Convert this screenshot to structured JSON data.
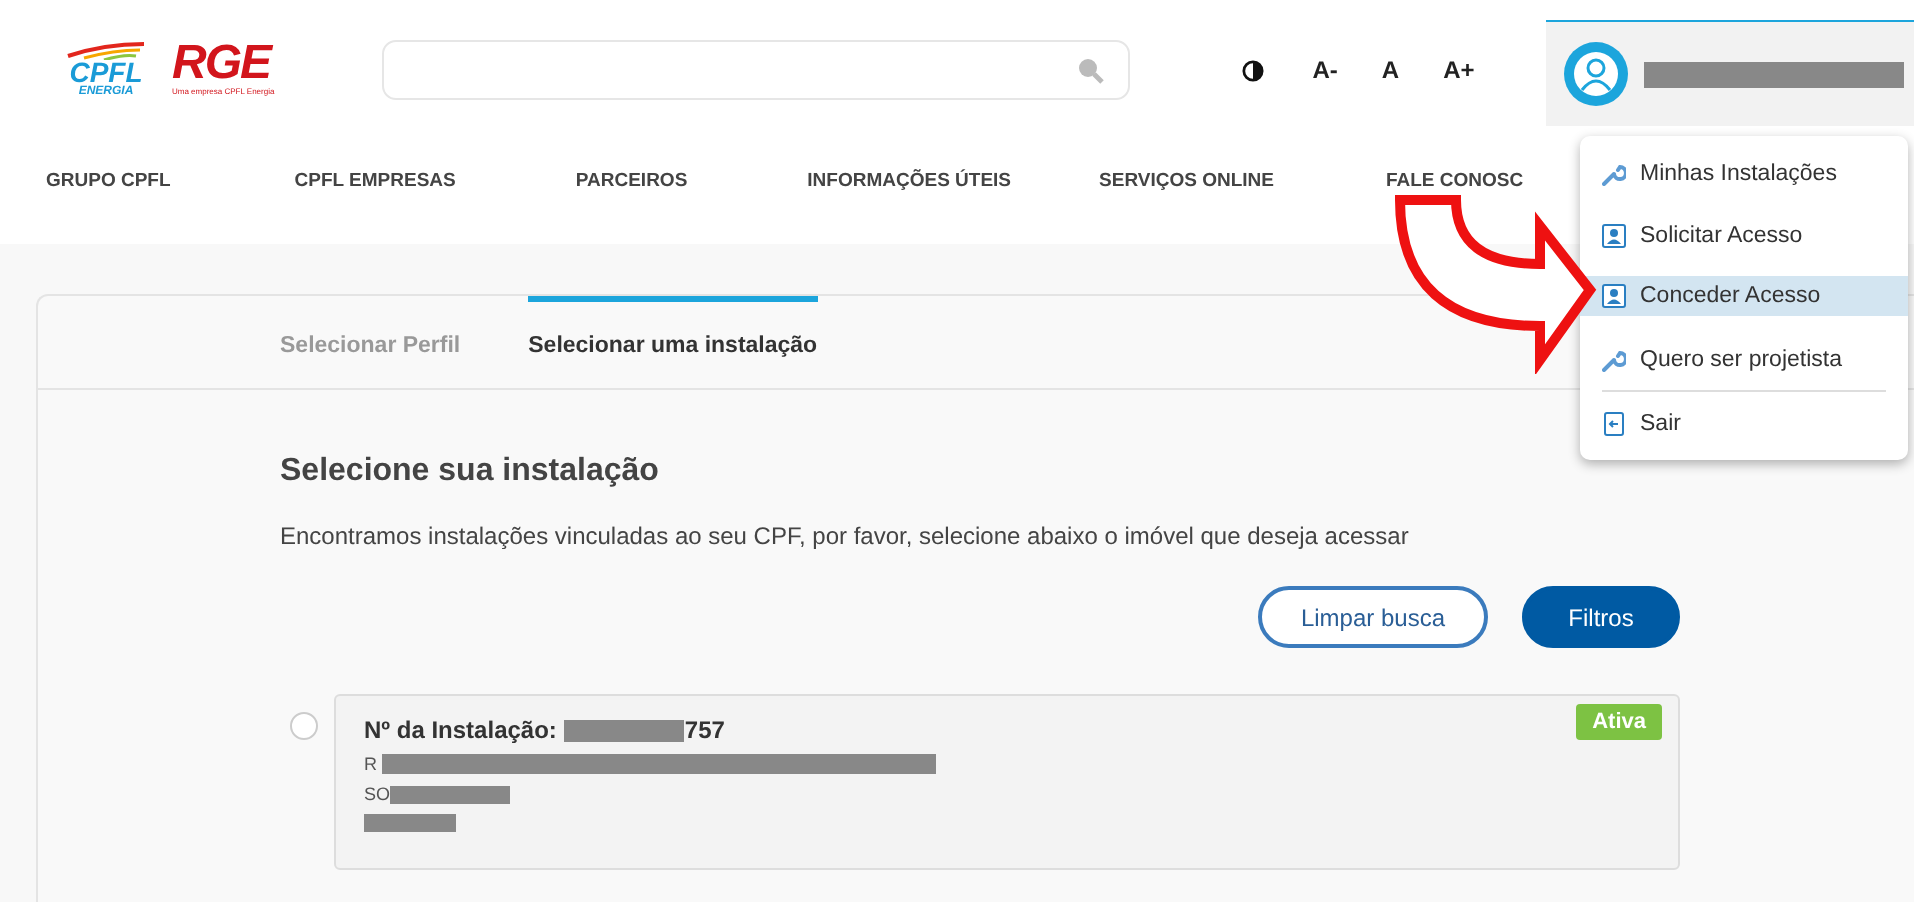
{
  "header": {
    "logo_primary": "CPFL",
    "logo_primary_sub": "ENERGIA",
    "logo_secondary": "RGE",
    "logo_secondary_tagline": "Uma empresa CPFL Energia",
    "accessibility": [
      "A-",
      "A",
      "A+"
    ]
  },
  "nav": [
    "GRUPO CPFL",
    "CPFL EMPRESAS",
    "PARCEIROS",
    "INFORMAÇÕES ÚTEIS",
    "SERVIÇOS ONLINE",
    "FALE CONOSC"
  ],
  "user_menu": {
    "items": [
      {
        "label": "Minhas Instalações",
        "kind": "wrench",
        "selected": false
      },
      {
        "label": "Solicitar Acesso",
        "kind": "person",
        "selected": false
      },
      {
        "label": "Conceder Acesso",
        "kind": "person",
        "selected": true
      },
      {
        "label": "Quero ser projetista",
        "kind": "wrench",
        "selected": false
      },
      {
        "label": "Sair",
        "kind": "exit",
        "selected": false
      }
    ]
  },
  "steps": [
    {
      "label": "Selecionar Perfil",
      "selected": false
    },
    {
      "label": "Selecionar uma instalação",
      "selected": true
    }
  ],
  "title": "Selecione sua instalação",
  "description": "Encontramos instalações vinculadas ao seu CPF, por favor, selecione abaixo o imóvel que deseja acessar",
  "buttons": [
    {
      "label": "Limpar busca",
      "kind": "outline"
    },
    {
      "label": "Filtros",
      "kind": "filled"
    }
  ],
  "installations": [
    {
      "number_label": "Nº da Instalação:",
      "number_suffix": "757",
      "address_start": "R",
      "city_start": "SO",
      "status": "Ativa",
      "selected": false
    }
  ]
}
